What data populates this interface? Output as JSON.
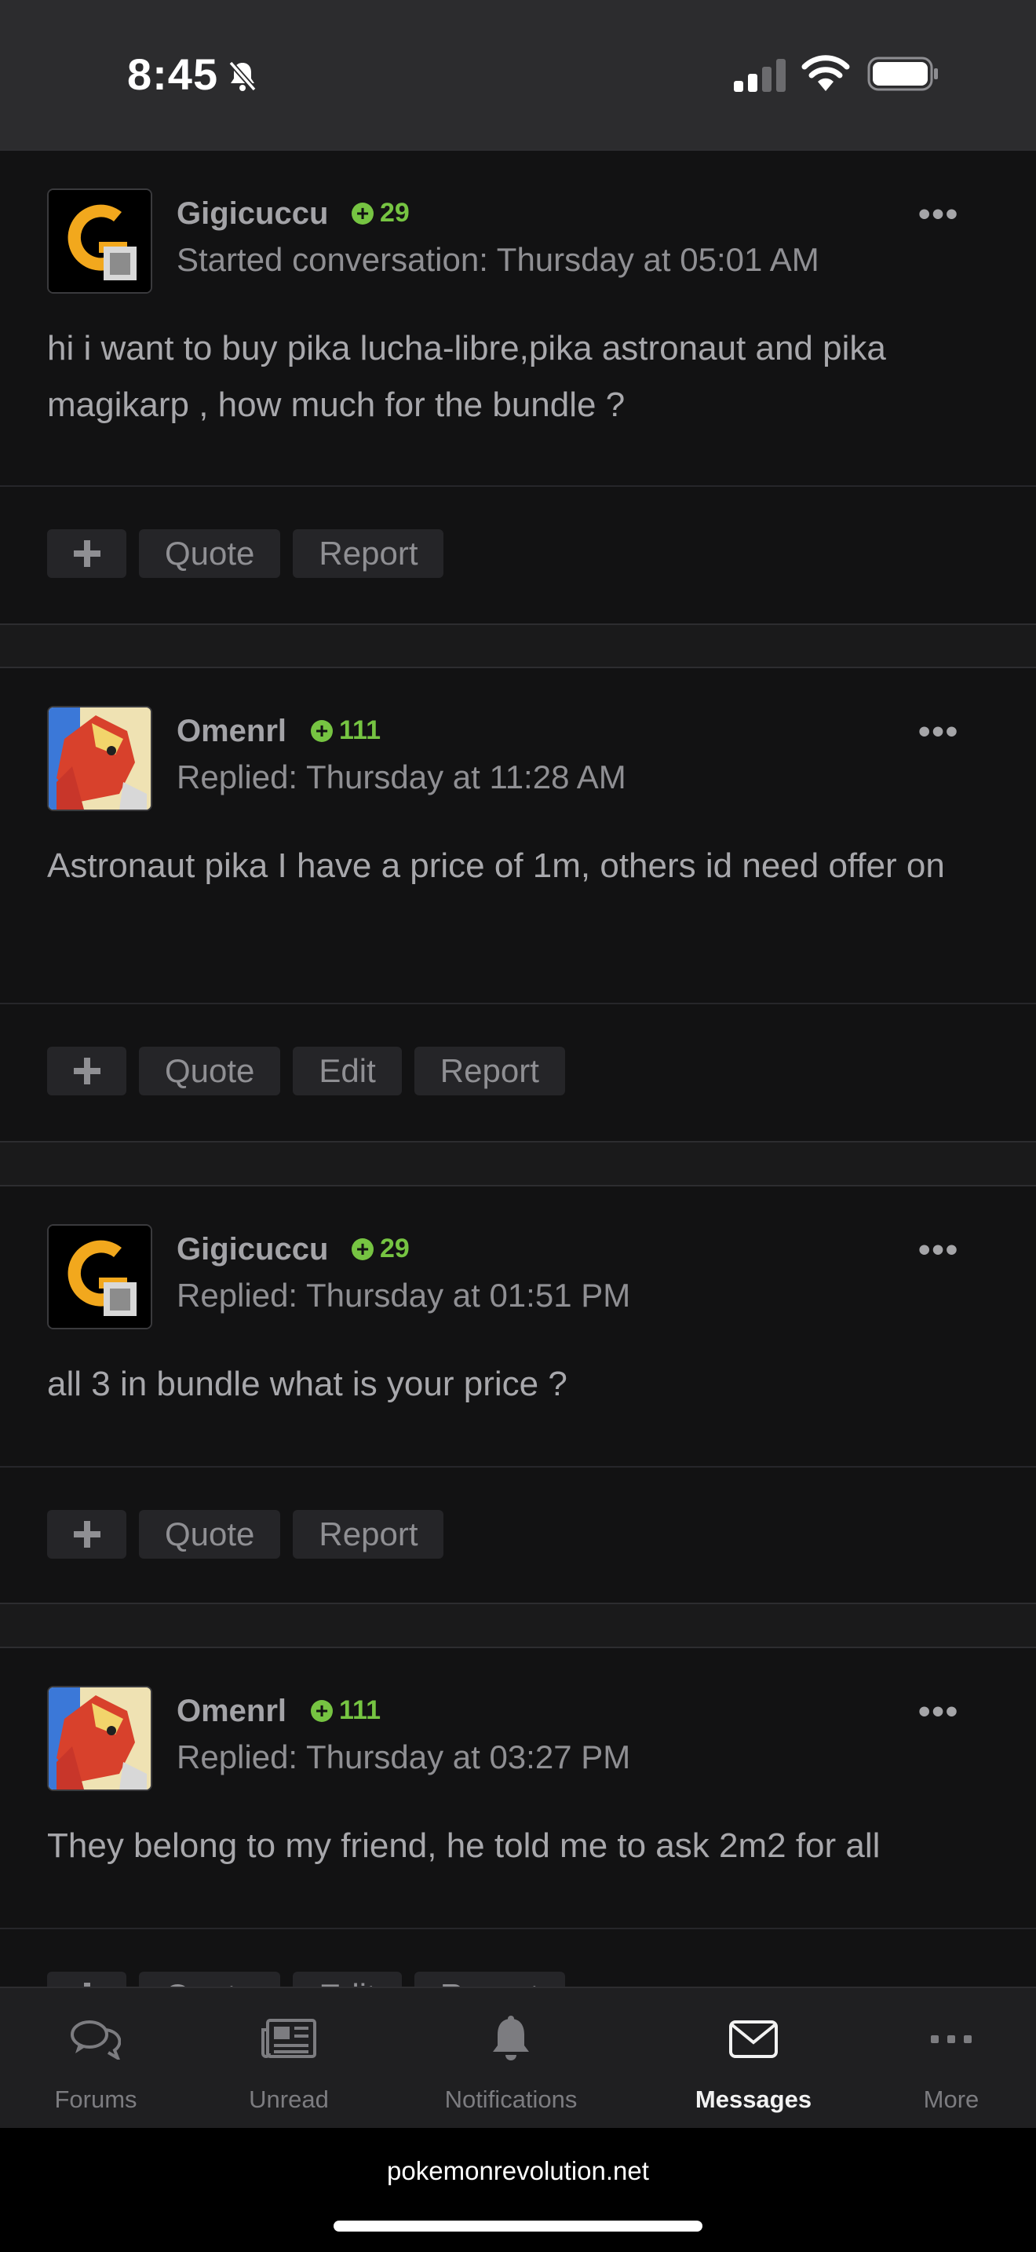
{
  "status_bar": {
    "time": "8:45"
  },
  "posts": [
    {
      "author": "Gigicuccu",
      "reputation": "29",
      "meta": "Started conversation: Thursday at 05:01 AM",
      "body": "hi i want to buy pika lucha-libre,pika astronaut and pika magikarp , how much for the bundle ?",
      "actions": [
        "Quote",
        "Report"
      ]
    },
    {
      "author": "Omenrl",
      "reputation": "111",
      "meta": "Replied: Thursday at 11:28 AM",
      "body": "Astronaut pika I have a price of 1m, others id need offer on",
      "actions": [
        "Quote",
        "Edit",
        "Report"
      ]
    },
    {
      "author": "Gigicuccu",
      "reputation": "29",
      "meta": "Replied: Thursday at 01:51 PM",
      "body": "all 3 in bundle what is your price ?",
      "actions": [
        "Quote",
        "Report"
      ]
    },
    {
      "author": "Omenrl",
      "reputation": "111",
      "meta": "Replied: Thursday at 03:27 PM",
      "body": "They belong to my friend, he told me to ask 2m2 for all",
      "actions": [
        "Quote",
        "Edit",
        "Report"
      ]
    }
  ],
  "nav": {
    "forums": "Forums",
    "unread": "Unread",
    "notifications": "Notifications",
    "messages": "Messages",
    "more": "More"
  },
  "browser": {
    "url": "pokemonrevolution.net"
  },
  "colors": {
    "reputation": "#76c442",
    "background": "#121213"
  }
}
